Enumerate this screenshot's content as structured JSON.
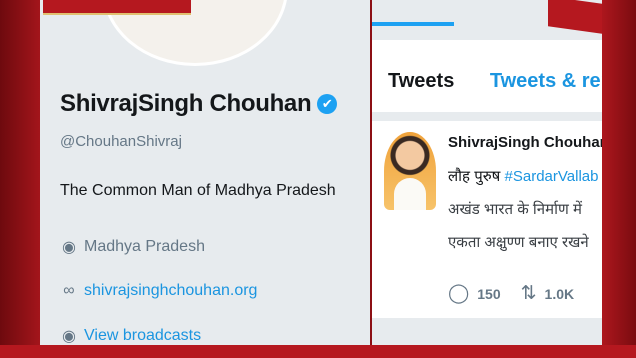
{
  "profile": {
    "name": "ShivrajSingh Chouhan",
    "verified_glyph": "✔",
    "handle": "@ChouhanShivraj",
    "bio": "The Common Man of Madhya Pradesh",
    "location": "Madhya Pradesh",
    "website": "shivrajsinghchouhan.org",
    "broadcasts": "View broadcasts",
    "icons": {
      "location": "location-pin-icon",
      "link": "link-icon",
      "broadcast": "broadcast-icon"
    }
  },
  "timeline": {
    "tabs": [
      "Tweets",
      "Tweets & rep"
    ],
    "tweet": {
      "author": "ShivrajSingh Chouhar",
      "line1_prefix": "लौह पुरुष ",
      "line1_hashtag": "#SardarVallab",
      "line2": "अखंड भारत के निर्माण में",
      "line3": "एकता अक्षुण्ण बनाए रखने",
      "replies": "150",
      "retweets": "1.0K"
    }
  },
  "colors": {
    "accent": "#1da1f2",
    "link": "#1b95e0",
    "brand_red": "#b5181f"
  }
}
